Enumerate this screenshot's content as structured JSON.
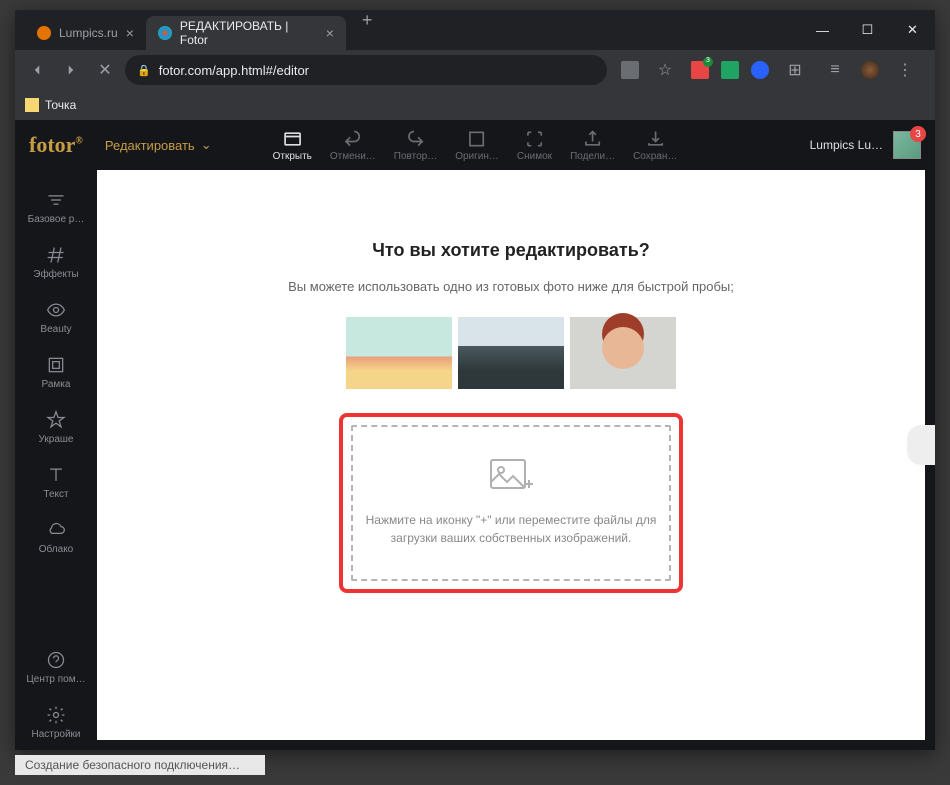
{
  "tabs": [
    {
      "label": "Lumpics.ru"
    },
    {
      "label": "РЕДАКТИРОВАТЬ | Fotor"
    }
  ],
  "url": "fotor.com/app.html#/editor",
  "bookmark": "Точка",
  "app": {
    "logo": "fotor",
    "mode": "Редактировать",
    "toolbar": [
      {
        "label": "Открыть",
        "key": "open"
      },
      {
        "label": "Отмени…",
        "key": "undo"
      },
      {
        "label": "Повтор…",
        "key": "redo"
      },
      {
        "label": "Оригин…",
        "key": "original"
      },
      {
        "label": "Снимок",
        "key": "snapshot"
      },
      {
        "label": "Подели…",
        "key": "share"
      },
      {
        "label": "Сохран…",
        "key": "save"
      }
    ],
    "user": "Lumpics Lu…",
    "badge": "3",
    "sidebar": [
      {
        "label": "Базовое р…",
        "key": "basic"
      },
      {
        "label": "Эффекты",
        "key": "effects"
      },
      {
        "label": "Beauty",
        "key": "beauty"
      },
      {
        "label": "Рамка",
        "key": "frame"
      },
      {
        "label": "Украше",
        "key": "decorate"
      },
      {
        "label": "Текст",
        "key": "text"
      },
      {
        "label": "Облако",
        "key": "cloud"
      }
    ],
    "sidebar_bottom": [
      {
        "label": "Центр пом…",
        "key": "help"
      },
      {
        "label": "Настройки",
        "key": "settings"
      }
    ],
    "heading": "Что вы хотите редактировать?",
    "subtext": "Вы можете использовать одно из готовых фото ниже для быстрой пробы;",
    "drop_text": "Нажмите на иконку \"+\" или переместите файлы для загрузки ваших собственных изображений."
  },
  "status": "Создание безопасного подключения…"
}
